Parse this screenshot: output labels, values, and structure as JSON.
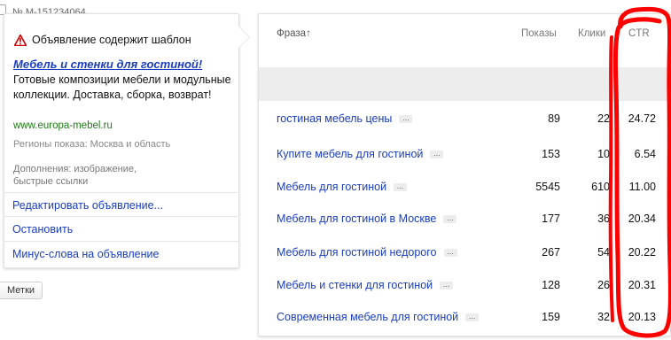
{
  "ad": {
    "number": "№ M-151234064",
    "warning": "Объявление содержит шаблон",
    "title": "Мебель и стенки для гостиной!",
    "text": "Готовые композиции мебели и модульные коллекции. Доставка, сборка, возврат!",
    "url": "www.europa-mebel.ru",
    "regions": "Регионы показа: Москва и область",
    "extras": "Дополнения: изображение, быстрые ссылки"
  },
  "menu": [
    "Редактировать объявление...",
    "Остановить",
    "Минус-слова на объявление"
  ],
  "tags_button": "Метки",
  "table": {
    "headers": {
      "phrase": "Фраза↑",
      "shows": "Показы",
      "clicks": "Клики",
      "ctr": "CTR"
    },
    "more_glyph": "...",
    "rows": [
      {
        "phrase": "гостиная мебель цены",
        "shows": "89",
        "clicks": "22",
        "ctr": "24.72"
      },
      {
        "phrase": "Купите мебель для гостиной",
        "shows": "153",
        "clicks": "10",
        "ctr": "6.54"
      },
      {
        "phrase": "Мебель для гостиной",
        "shows": "5545",
        "clicks": "610",
        "ctr": "11.00"
      },
      {
        "phrase": "Мебель для гостиной в Москве",
        "shows": "177",
        "clicks": "36",
        "ctr": "20.34"
      },
      {
        "phrase": "Мебель для гостиной недорого",
        "shows": "267",
        "clicks": "54",
        "ctr": "20.22"
      },
      {
        "phrase": "Мебель и стенки для гостиной",
        "shows": "128",
        "clicks": "26",
        "ctr": "20.31"
      },
      {
        "phrase": "Современная мебель для гостиной",
        "shows": "159",
        "clicks": "32",
        "ctr": "20.13"
      }
    ]
  },
  "colors": {
    "link": "#1a3dc1",
    "url": "#207a16",
    "warning": "#cc0000",
    "annotation": "#ff0000"
  }
}
